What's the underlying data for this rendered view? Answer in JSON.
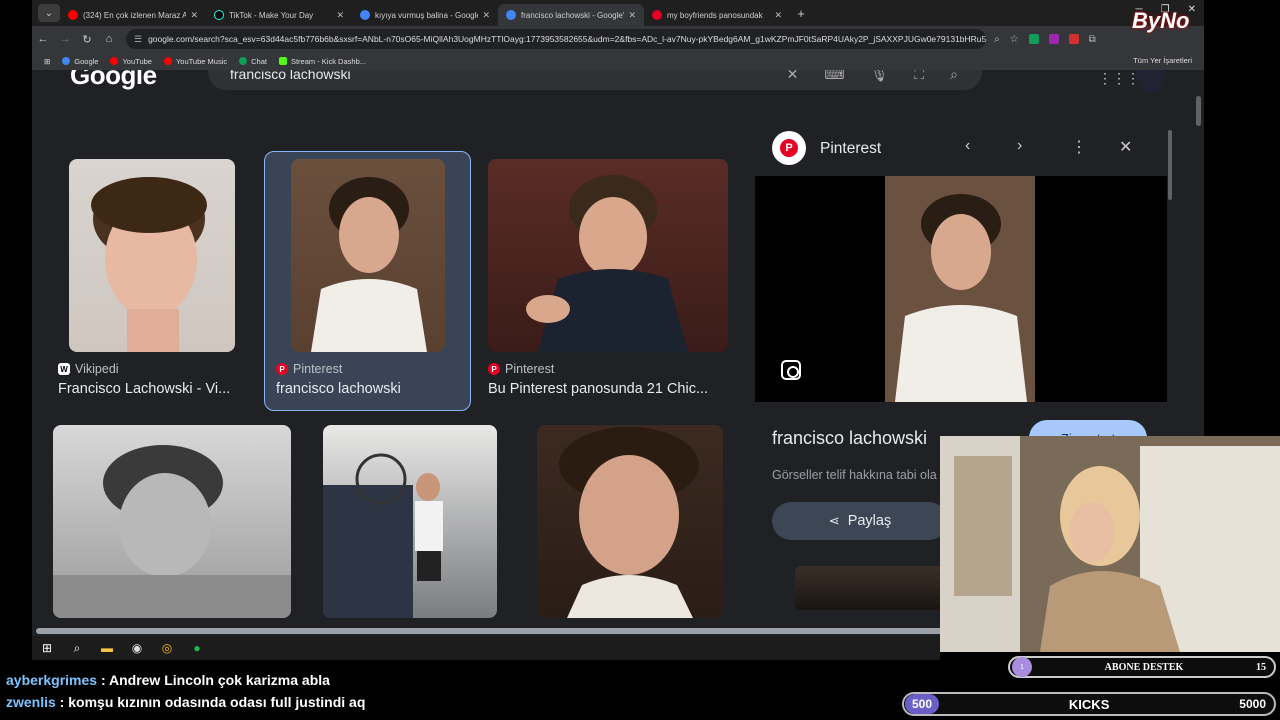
{
  "browser": {
    "tabs": [
      {
        "label": "(324) En çok izlenen Maraz Ali",
        "color": "#ff0000"
      },
      {
        "label": "TikTok - Make Your Day",
        "color": "#222222"
      },
      {
        "label": "kıyıya vurmuş balina - Google'",
        "color": "#4285f4"
      },
      {
        "label": "francisco lachowski - Google'd",
        "color": "#4285f4",
        "active": true
      },
      {
        "label": "my boyfriends panosundak",
        "color": "#e60023"
      }
    ],
    "url": "google.com/search?sca_esv=63d44ac5fb776b6b&sxsrf=ANbL-n70sO65-MiQllAh3UogMHzTTlOayg:1773953582655&udm=2&fbs=ADc_l-av7Nuy-pkYBedg6AM_g1wKZPmJF0tSaRP4UAky2P_jSAXXPJUGw0e79131bHRu5v...",
    "bookmarks": [
      {
        "label": "Google",
        "color": "#4285f4"
      },
      {
        "label": "YouTube",
        "color": "#ff0000"
      },
      {
        "label": "YouTube Music",
        "color": "#ff0000"
      },
      {
        "label": "Chat",
        "color": "#0f9d58"
      },
      {
        "label": "Stream - Kick Dashb...",
        "color": "#53fc18"
      }
    ],
    "bookmarks_right": "Tüm Yer İşaretleri"
  },
  "google": {
    "logo": "Google",
    "query": "francisco lachowski"
  },
  "results": [
    {
      "source": "Vikipedi",
      "title": "Francisco Lachowski - Vi...",
      "source_icon": "W"
    },
    {
      "source": "Pinterest",
      "title": "francisco lachowski",
      "source_icon": "P"
    },
    {
      "source": "Pinterest",
      "title": "Bu Pinterest panosunda 21 Chic...",
      "source_icon": "P"
    }
  ],
  "panel": {
    "source": "Pinterest",
    "title": "francisco lachowski",
    "visit_label": "Ziyaret et",
    "note": "Görseller telif hakkına tabi ola",
    "share_label": "Paylaş"
  },
  "chat": [
    {
      "user": "ayberkgrimes",
      "text": "Andrew Lincoln çok karizma abla"
    },
    {
      "user": "zwenlis",
      "text": "komşu kızının odasında odası full justindi aq"
    }
  ],
  "overlays": {
    "sub_goal": {
      "label": "ABONE DESTEK",
      "count": "15",
      "current": "1"
    },
    "kick_goal": {
      "label": "KICKS",
      "current": "500",
      "goal": "5000"
    },
    "brand": "ByNo"
  }
}
